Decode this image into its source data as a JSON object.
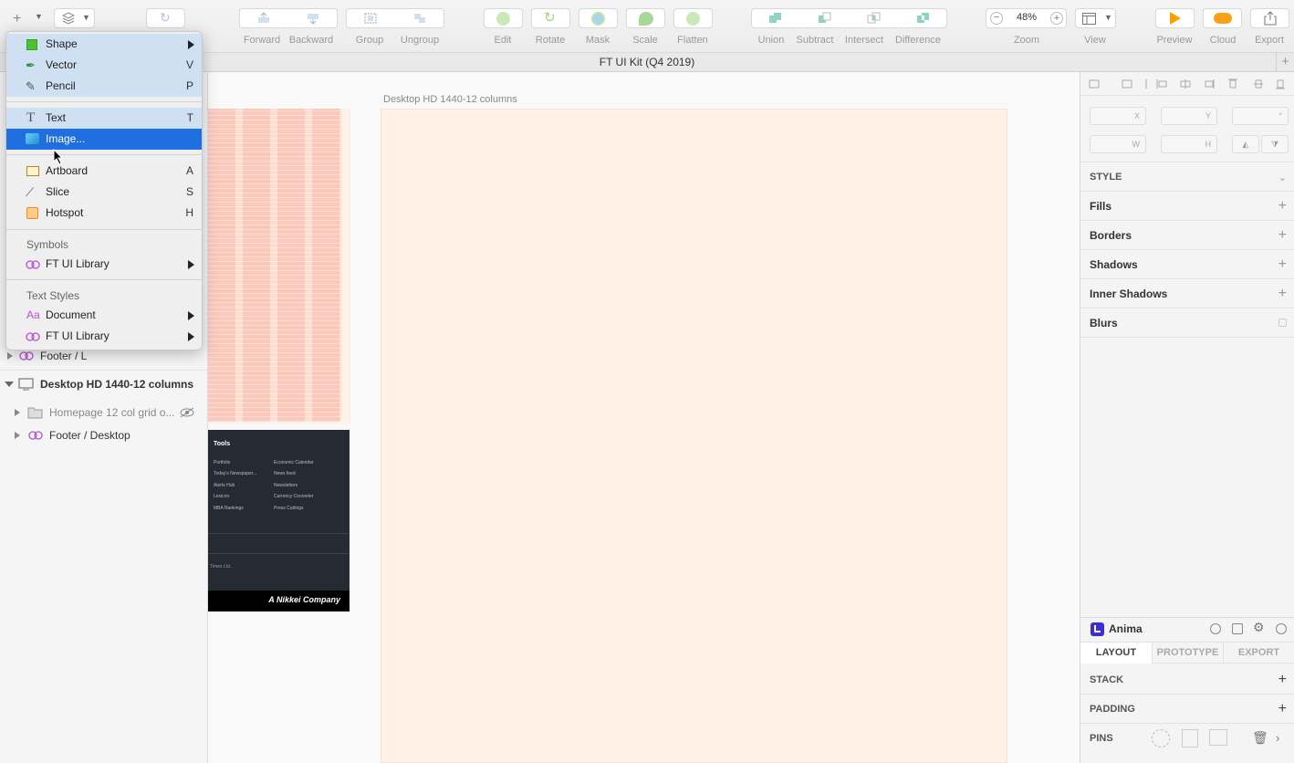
{
  "toolbar": {
    "zoom_value": "48%",
    "labels": {
      "forward": "Forward",
      "backward": "Backward",
      "group": "Group",
      "ungroup": "Ungroup",
      "edit": "Edit",
      "rotate": "Rotate",
      "mask": "Mask",
      "scale": "Scale",
      "flatten": "Flatten",
      "union": "Union",
      "subtract": "Subtract",
      "intersect": "Intersect",
      "difference": "Difference",
      "zoom": "Zoom",
      "view": "View",
      "preview": "Preview",
      "cloud": "Cloud",
      "export": "Export"
    }
  },
  "document": {
    "title": "FT UI Kit (Q4 2019)"
  },
  "insert_menu": {
    "items": [
      {
        "label": "Shape",
        "shortcut": ""
      },
      {
        "label": "Vector",
        "shortcut": "V"
      },
      {
        "label": "Pencil",
        "shortcut": "P"
      },
      {
        "label": "Text",
        "shortcut": "T"
      },
      {
        "label": "Image...",
        "shortcut": ""
      },
      {
        "label": "Artboard",
        "shortcut": "A"
      },
      {
        "label": "Slice",
        "shortcut": "S"
      },
      {
        "label": "Hotspot",
        "shortcut": "H"
      }
    ],
    "symbols_header": "Symbols",
    "symbols_library": "FT UI Library",
    "text_styles_header": "Text Styles",
    "text_styles_document": "Document",
    "text_styles_library": "FT UI Library"
  },
  "layers": {
    "footer_l": "Footer / L",
    "artboard": "Desktop HD 1440-12 columns",
    "grid_group": "Homepage 12 col grid o...",
    "footer_desktop": "Footer / Desktop"
  },
  "canvas": {
    "artboard_label": "Desktop HD 1440-12 columns",
    "footer": {
      "heading": "Tools",
      "col1": [
        "Portfolio",
        "Today's Newspaper...",
        "Alerts Hub",
        "Lexicon",
        "MBA Rankings"
      ],
      "col2": [
        "Economic Calendar",
        "News feed",
        "Newsletters",
        "Currency Converter",
        "Press Cuttings"
      ],
      "copyright": "Times Ltd.",
      "brand": "A Nikkei Company"
    }
  },
  "inspector": {
    "fields": {
      "x": "X",
      "y": "Y",
      "rot": "°",
      "w": "W",
      "h": "H"
    },
    "style": "STYLE",
    "fills": "Fills",
    "borders": "Borders",
    "shadows": "Shadows",
    "inner_shadows": "Inner Shadows",
    "blurs": "Blurs",
    "anima": {
      "title": "Anima",
      "tabs": [
        "LAYOUT",
        "PROTOTYPE",
        "EXPORT"
      ],
      "stack": "STACK",
      "padding": "PADDING",
      "pins": "PINS"
    }
  },
  "colors": {
    "accent": "#1f6fe0",
    "artboard_fill": "#fff1e5",
    "grid_red": "#fbc4b8",
    "footer_dark": "#262a33",
    "anima_purple": "#3b2fd4",
    "preview_orange": "#ff9f00"
  }
}
